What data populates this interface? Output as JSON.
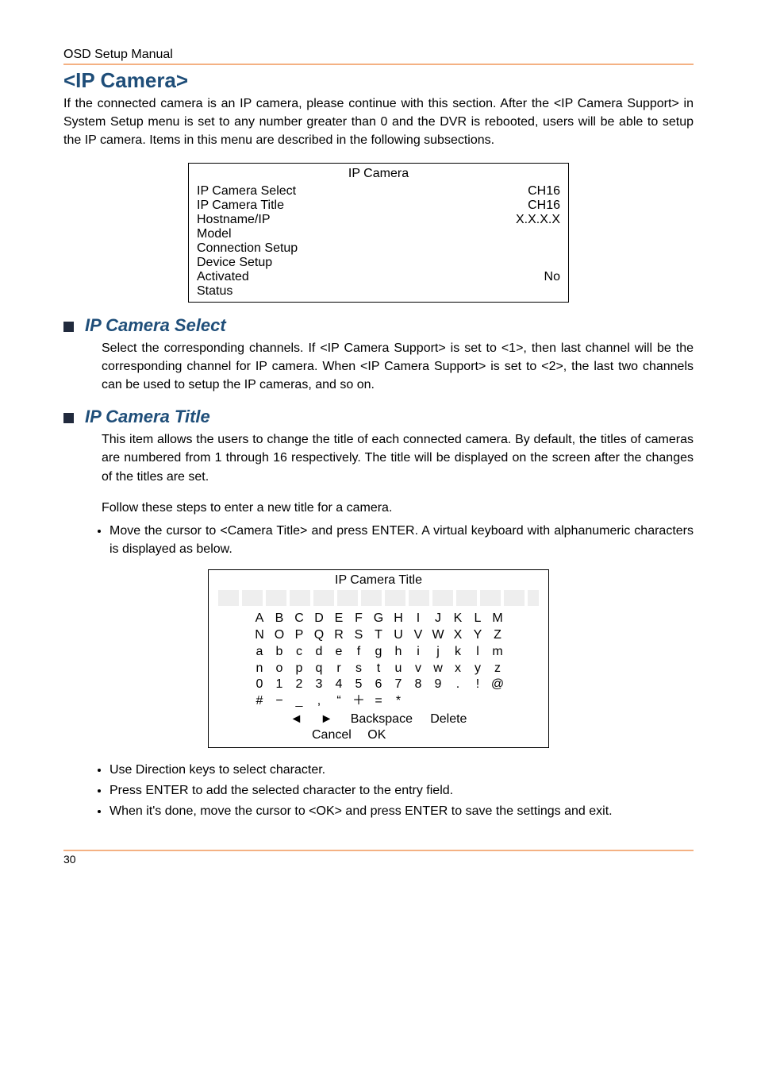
{
  "header": {
    "manual_title": "OSD Setup Manual"
  },
  "section": {
    "title": "<IP Camera>",
    "intro": "If the connected camera is an IP camera, please continue with this section. After the <IP Camera Support> in System Setup menu is set to any number greater than 0 and the DVR is rebooted, users will be able to setup the IP camera. Items in this menu are described in the following subsections."
  },
  "ipcamera_table": {
    "title": "IP Camera",
    "rows": [
      {
        "label": "IP Camera Select",
        "value": "CH16"
      },
      {
        "label": "IP Camera Title",
        "value": "CH16"
      },
      {
        "label": "Hostname/IP",
        "value": "X.X.X.X"
      },
      {
        "label": "Model",
        "value": ""
      },
      {
        "label": "Connection Setup",
        "value": ""
      },
      {
        "label": "Device Setup",
        "value": ""
      },
      {
        "label": "Activated",
        "value": "No"
      },
      {
        "label": "Status",
        "value": ""
      }
    ]
  },
  "select_section": {
    "title": "IP Camera Select",
    "body": "Select the corresponding channels. If <IP Camera Support> is set to <1>, then last channel will be the corresponding channel for IP camera. When <IP Camera Support> is set to <2>, the last two channels can be used to setup the IP cameras, and so on."
  },
  "title_section": {
    "title": "IP Camera Title",
    "body1": "This item allows the users to change the title of each connected camera. By default, the titles of cameras are numbered from 1 through 16 respectively. The title will be displayed on the screen after the changes of the titles are set.",
    "body2": "Follow these steps to enter a new title for a camera.",
    "step1": "Move the cursor to <Camera Title> and press ENTER. A virtual keyboard with alphanumeric characters is displayed as below."
  },
  "keyboard": {
    "title": "IP Camera Title",
    "rows": [
      [
        "A",
        "B",
        "C",
        "D",
        "E",
        "F",
        "G",
        "H",
        "I",
        "J",
        "K",
        "L",
        "M"
      ],
      [
        "N",
        "O",
        "P",
        "Q",
        "R",
        "S",
        "T",
        "U",
        "V",
        "W",
        "X",
        "Y",
        "Z"
      ],
      [
        "a",
        "b",
        "c",
        "d",
        "e",
        "f",
        "g",
        "h",
        "i",
        "j",
        "k",
        "l",
        "m"
      ],
      [
        "n",
        "o",
        "p",
        "q",
        "r",
        "s",
        "t",
        "u",
        "v",
        "w",
        "x",
        "y",
        "z"
      ],
      [
        "0",
        "1",
        "2",
        "3",
        "4",
        "5",
        "6",
        "7",
        "8",
        "9",
        ".",
        "!",
        "@"
      ],
      [
        "#",
        "−",
        "_",
        ",",
        "“",
        "＋",
        "=",
        "*",
        "",
        "",
        "",
        "",
        ""
      ]
    ],
    "controls": {
      "left": "◄",
      "right": "►",
      "backspace": "Backspace",
      "delete": "Delete"
    },
    "cancel": "Cancel",
    "ok": "OK"
  },
  "final_bullets": [
    "Use Direction keys to select character.",
    "Press ENTER to add the selected character to the entry field.",
    "When it's done, move the cursor to <OK> and press ENTER to save the settings and exit."
  ],
  "footer": {
    "page": "30"
  }
}
